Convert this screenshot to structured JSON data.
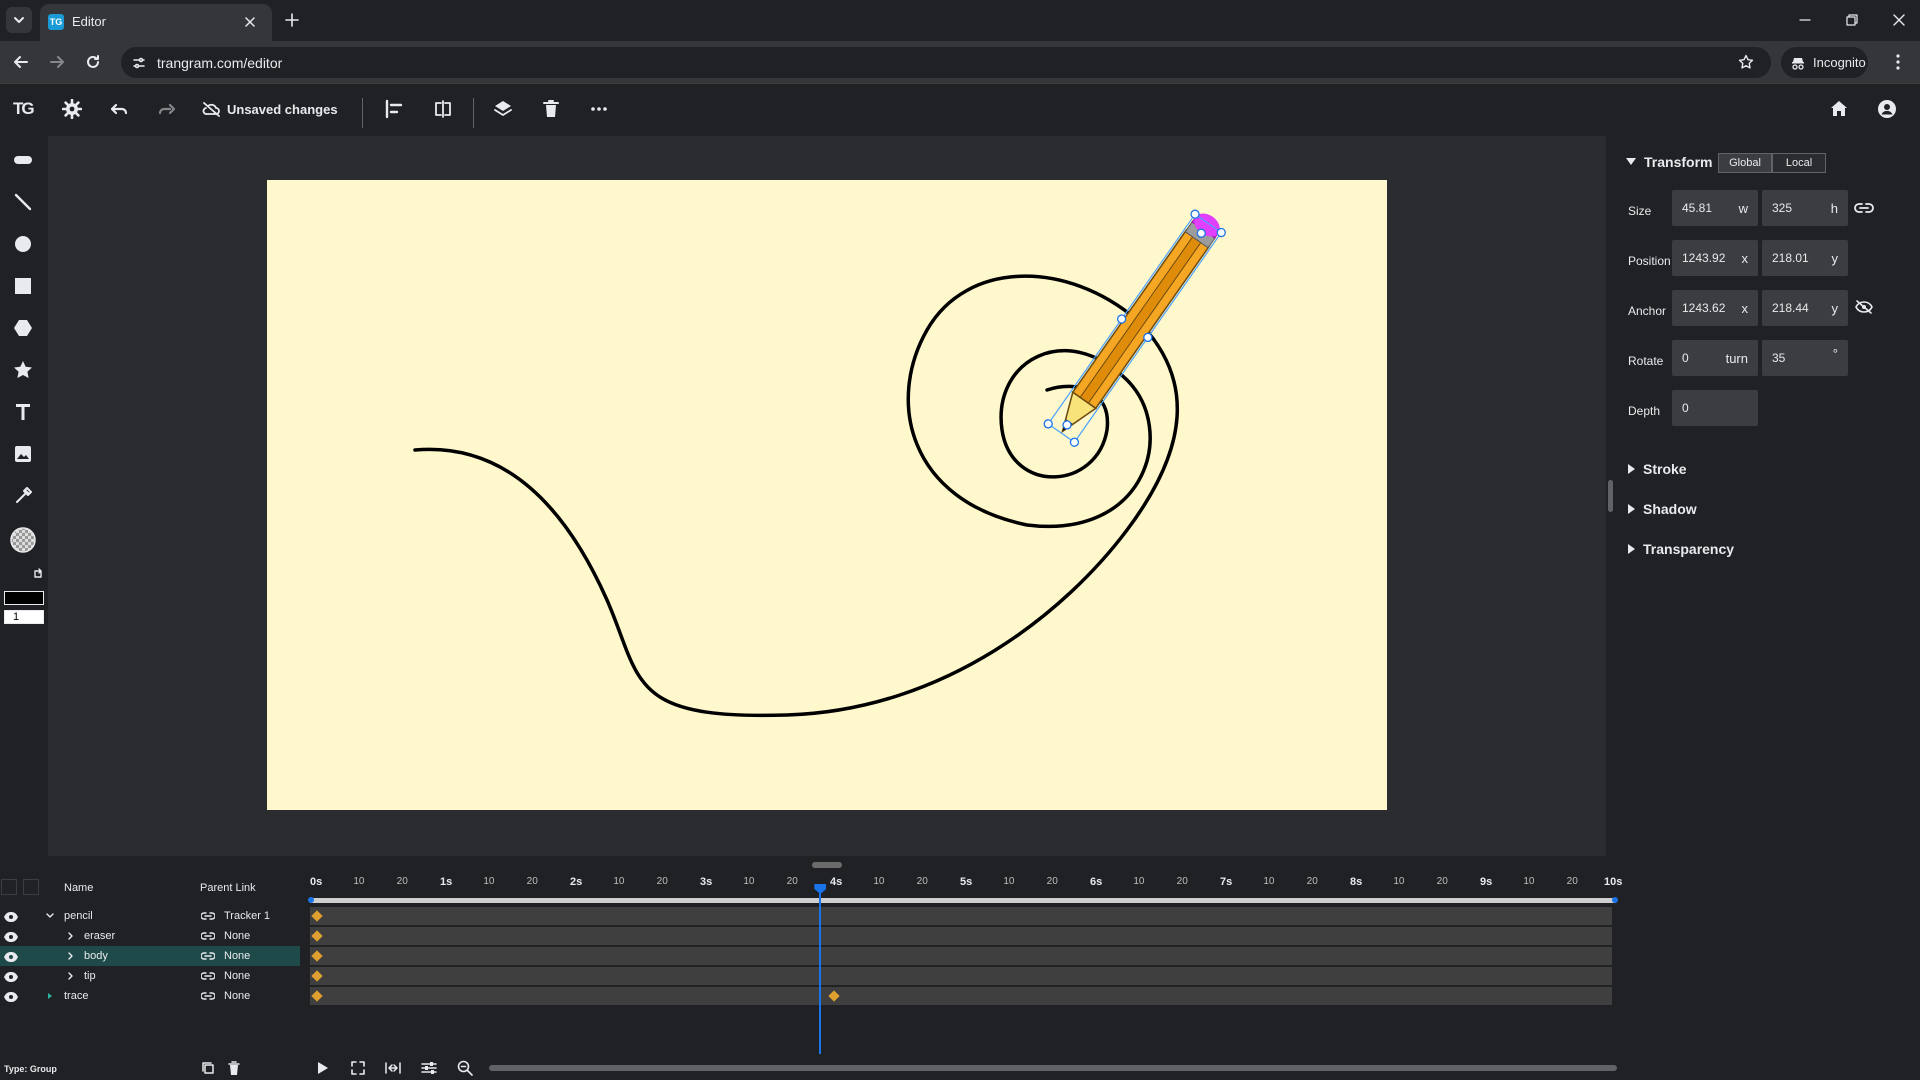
{
  "browser": {
    "tab_title": "Editor",
    "url": "trangram.com/editor",
    "incognito_label": "Incognito"
  },
  "toolbar": {
    "save_status": "Unsaved changes"
  },
  "left_tools": {
    "stroke_width": "1",
    "fill_color": "#000000"
  },
  "properties": {
    "transform_title": "Transform",
    "global_label": "Global",
    "local_label": "Local",
    "size_label": "Size",
    "size_w": "45.81",
    "size_w_unit": "w",
    "size_h": "325",
    "size_h_unit": "h",
    "position_label": "Position",
    "position_x": "1243.92",
    "position_x_unit": "x",
    "position_y": "218.01",
    "position_y_unit": "y",
    "anchor_label": "Anchor",
    "anchor_x": "1243.62",
    "anchor_x_unit": "x",
    "anchor_y": "218.44",
    "anchor_y_unit": "y",
    "rotate_label": "Rotate",
    "rotate_turn": "0",
    "rotate_turn_unit": "turn",
    "rotate_deg": "35",
    "rotate_deg_unit": "°",
    "depth_label": "Depth",
    "depth": "0",
    "stroke_title": "Stroke",
    "shadow_title": "Shadow",
    "transparency_title": "Transparency"
  },
  "layers": {
    "name_header": "Name",
    "parent_header": "Parent Link",
    "rows": [
      {
        "name": "pencil",
        "parent": "Tracker 1"
      },
      {
        "name": "eraser",
        "parent": "None"
      },
      {
        "name": "body",
        "parent": "None"
      },
      {
        "name": "tip",
        "parent": "None"
      },
      {
        "name": "trace",
        "parent": "None"
      }
    ],
    "type_label": "Type: Group"
  },
  "timeline": {
    "ticks": [
      "0s",
      "10",
      "20",
      "1s",
      "10",
      "20",
      "2s",
      "10",
      "20",
      "3s",
      "10",
      "20",
      "4s",
      "10",
      "20",
      "5s",
      "10",
      "20",
      "6s",
      "10",
      "20",
      "7s",
      "10",
      "20",
      "8s",
      "10",
      "20",
      "9s",
      "10",
      "20",
      "10s"
    ],
    "playhead_seconds": 3.9,
    "duration_seconds": 10
  },
  "colors": {
    "stage_bg": "#fff8cc",
    "selected_row": "#1f4a4a",
    "keyframe": "#e0a030",
    "playhead": "#1a73e8"
  }
}
